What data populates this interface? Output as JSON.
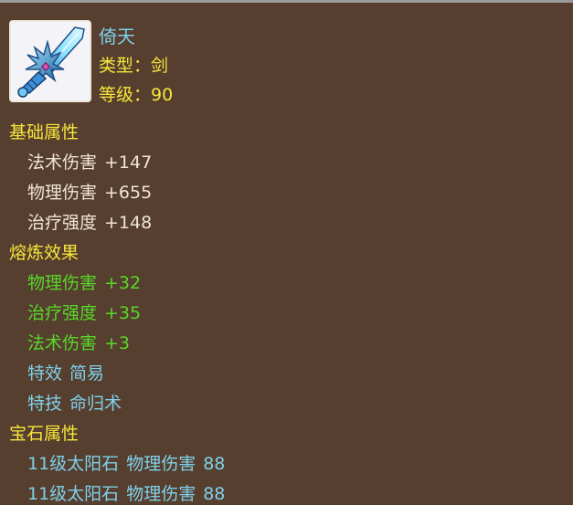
{
  "item": {
    "name": "倚天",
    "type_label": "类型：",
    "type_value": "剑",
    "level_label": "等级：",
    "level_value": "90",
    "icon": "ice-sword-icon"
  },
  "sections": {
    "base_title": "基础属性",
    "forge_title": "熔炼效果",
    "gem_title": "宝石属性"
  },
  "base_attributes": [
    {
      "name": "法术伤害",
      "value": "+147"
    },
    {
      "name": "物理伤害",
      "value": "+655"
    },
    {
      "name": "治疗强度",
      "value": "+148"
    }
  ],
  "forge_attributes": [
    {
      "name": "物理伤害",
      "value": "+32"
    },
    {
      "name": "治疗强度",
      "value": "+35"
    },
    {
      "name": "法术伤害",
      "value": "+3"
    }
  ],
  "special": [
    {
      "name": "特效",
      "value": "简易"
    },
    {
      "name": "特技",
      "value": "命归术"
    }
  ],
  "gems": [
    {
      "name": "11级太阳石",
      "attr": "物理伤害",
      "value": "88"
    },
    {
      "name": "11级太阳石",
      "attr": "物理伤害",
      "value": "88"
    }
  ],
  "colors": {
    "background": "#563f2f",
    "name": "#7fd0ea",
    "section_title": "#f6e63a",
    "base": "#f0e4d6",
    "forge": "#59d62a",
    "gem": "#7fd0ea"
  }
}
